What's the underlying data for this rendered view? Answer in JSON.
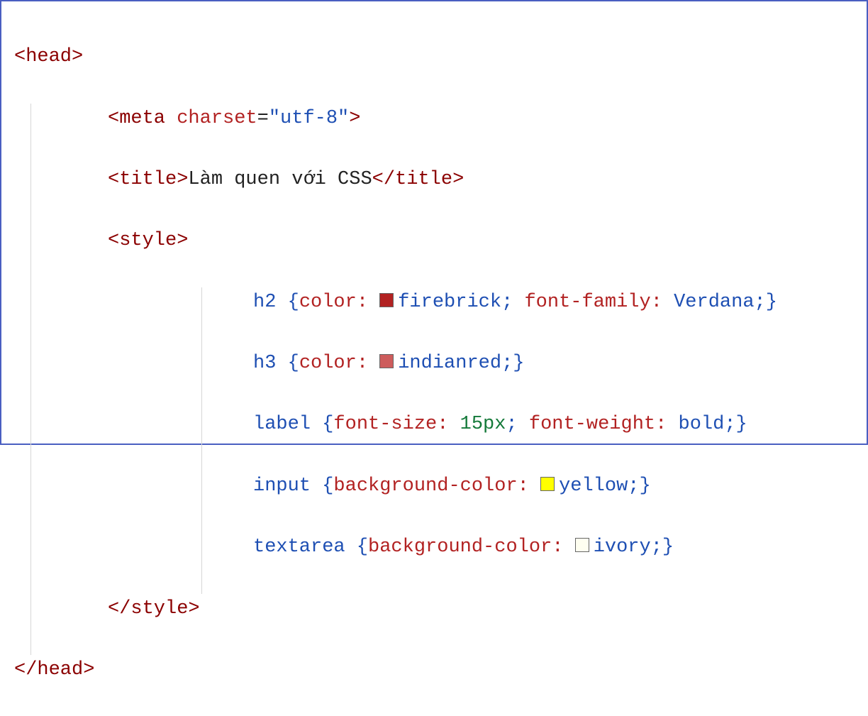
{
  "lines": {
    "l0": {
      "open": "<",
      "tag": "head",
      "close": ">"
    },
    "l1": {
      "open": "<",
      "tag": "meta",
      "sp": " ",
      "attr": "charset",
      "eq": "=",
      "val": "\"utf-8\"",
      "close": ">"
    },
    "l2": {
      "open": "<",
      "tag": "title",
      "close1": ">",
      "text": "Làm quen với CSS",
      "open2": "</",
      "tag2": "title",
      "close2": ">"
    },
    "l3": {
      "open": "<",
      "tag": "style",
      "close": ">"
    },
    "l4": {
      "sel": "h2 ",
      "lb": "{",
      "p1": "color",
      "c1": ": ",
      "sw1": "firebrick",
      "v1": "firebrick",
      "s1": ";",
      "sp": " ",
      "p2": "font-family",
      "c2": ": ",
      "v2": "Verdana",
      "s2": ";",
      "rb": "}"
    },
    "l5": {
      "sel": "h3 ",
      "lb": "{",
      "p1": "color",
      "c1": ": ",
      "sw1": "indianred",
      "v1": "indianred",
      "s1": ";",
      "rb": "}"
    },
    "l6": {
      "sel": "label ",
      "lb": "{",
      "p1": "font-size",
      "c1": ": ",
      "v1num": "15px",
      "s1": ";",
      "sp": " ",
      "p2": "font-weight",
      "c2": ": ",
      "v2": "bold",
      "s2": ";",
      "rb": "}"
    },
    "l7": {
      "sel": "input ",
      "lb": "{",
      "p1": "background-color",
      "c1": ": ",
      "sw1": "yellow",
      "v1": "yellow",
      "s1": ";",
      "rb": "}"
    },
    "l8": {
      "sel": "textarea ",
      "lb": "{",
      "p1": "background-color",
      "c1": ": ",
      "sw1": "ivory",
      "v1": "ivory",
      "s1": ";",
      "rb": "}"
    },
    "l9": {
      "open": "</",
      "tag": "style",
      "close": ">"
    },
    "l10": {
      "open": "</",
      "tag": "head",
      "close": ">"
    }
  }
}
